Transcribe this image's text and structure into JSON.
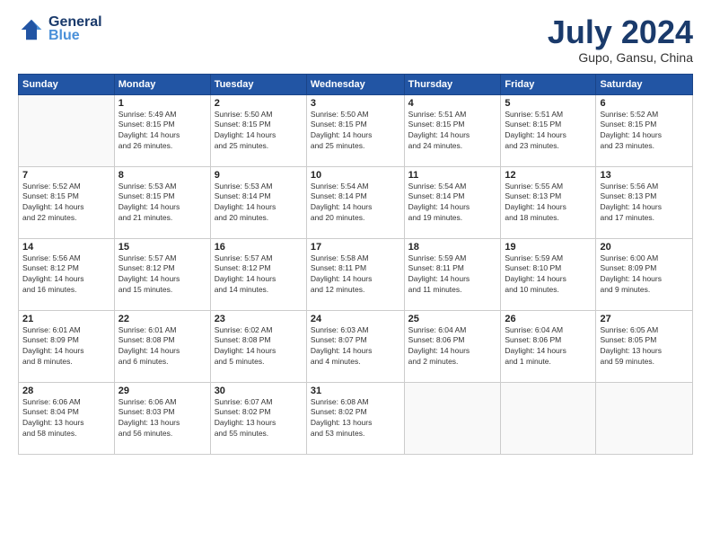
{
  "logo": {
    "line1": "General",
    "line2": "Blue"
  },
  "title": "July 2024",
  "location": "Gupo, Gansu, China",
  "weekdays": [
    "Sunday",
    "Monday",
    "Tuesday",
    "Wednesday",
    "Thursday",
    "Friday",
    "Saturday"
  ],
  "weeks": [
    [
      {
        "day": "",
        "info": ""
      },
      {
        "day": "1",
        "info": "Sunrise: 5:49 AM\nSunset: 8:15 PM\nDaylight: 14 hours\nand 26 minutes."
      },
      {
        "day": "2",
        "info": "Sunrise: 5:50 AM\nSunset: 8:15 PM\nDaylight: 14 hours\nand 25 minutes."
      },
      {
        "day": "3",
        "info": "Sunrise: 5:50 AM\nSunset: 8:15 PM\nDaylight: 14 hours\nand 25 minutes."
      },
      {
        "day": "4",
        "info": "Sunrise: 5:51 AM\nSunset: 8:15 PM\nDaylight: 14 hours\nand 24 minutes."
      },
      {
        "day": "5",
        "info": "Sunrise: 5:51 AM\nSunset: 8:15 PM\nDaylight: 14 hours\nand 23 minutes."
      },
      {
        "day": "6",
        "info": "Sunrise: 5:52 AM\nSunset: 8:15 PM\nDaylight: 14 hours\nand 23 minutes."
      }
    ],
    [
      {
        "day": "7",
        "info": "Sunrise: 5:52 AM\nSunset: 8:15 PM\nDaylight: 14 hours\nand 22 minutes."
      },
      {
        "day": "8",
        "info": "Sunrise: 5:53 AM\nSunset: 8:15 PM\nDaylight: 14 hours\nand 21 minutes."
      },
      {
        "day": "9",
        "info": "Sunrise: 5:53 AM\nSunset: 8:14 PM\nDaylight: 14 hours\nand 20 minutes."
      },
      {
        "day": "10",
        "info": "Sunrise: 5:54 AM\nSunset: 8:14 PM\nDaylight: 14 hours\nand 20 minutes."
      },
      {
        "day": "11",
        "info": "Sunrise: 5:54 AM\nSunset: 8:14 PM\nDaylight: 14 hours\nand 19 minutes."
      },
      {
        "day": "12",
        "info": "Sunrise: 5:55 AM\nSunset: 8:13 PM\nDaylight: 14 hours\nand 18 minutes."
      },
      {
        "day": "13",
        "info": "Sunrise: 5:56 AM\nSunset: 8:13 PM\nDaylight: 14 hours\nand 17 minutes."
      }
    ],
    [
      {
        "day": "14",
        "info": "Sunrise: 5:56 AM\nSunset: 8:12 PM\nDaylight: 14 hours\nand 16 minutes."
      },
      {
        "day": "15",
        "info": "Sunrise: 5:57 AM\nSunset: 8:12 PM\nDaylight: 14 hours\nand 15 minutes."
      },
      {
        "day": "16",
        "info": "Sunrise: 5:57 AM\nSunset: 8:12 PM\nDaylight: 14 hours\nand 14 minutes."
      },
      {
        "day": "17",
        "info": "Sunrise: 5:58 AM\nSunset: 8:11 PM\nDaylight: 14 hours\nand 12 minutes."
      },
      {
        "day": "18",
        "info": "Sunrise: 5:59 AM\nSunset: 8:11 PM\nDaylight: 14 hours\nand 11 minutes."
      },
      {
        "day": "19",
        "info": "Sunrise: 5:59 AM\nSunset: 8:10 PM\nDaylight: 14 hours\nand 10 minutes."
      },
      {
        "day": "20",
        "info": "Sunrise: 6:00 AM\nSunset: 8:09 PM\nDaylight: 14 hours\nand 9 minutes."
      }
    ],
    [
      {
        "day": "21",
        "info": "Sunrise: 6:01 AM\nSunset: 8:09 PM\nDaylight: 14 hours\nand 8 minutes."
      },
      {
        "day": "22",
        "info": "Sunrise: 6:01 AM\nSunset: 8:08 PM\nDaylight: 14 hours\nand 6 minutes."
      },
      {
        "day": "23",
        "info": "Sunrise: 6:02 AM\nSunset: 8:08 PM\nDaylight: 14 hours\nand 5 minutes."
      },
      {
        "day": "24",
        "info": "Sunrise: 6:03 AM\nSunset: 8:07 PM\nDaylight: 14 hours\nand 4 minutes."
      },
      {
        "day": "25",
        "info": "Sunrise: 6:04 AM\nSunset: 8:06 PM\nDaylight: 14 hours\nand 2 minutes."
      },
      {
        "day": "26",
        "info": "Sunrise: 6:04 AM\nSunset: 8:06 PM\nDaylight: 14 hours\nand 1 minute."
      },
      {
        "day": "27",
        "info": "Sunrise: 6:05 AM\nSunset: 8:05 PM\nDaylight: 13 hours\nand 59 minutes."
      }
    ],
    [
      {
        "day": "28",
        "info": "Sunrise: 6:06 AM\nSunset: 8:04 PM\nDaylight: 13 hours\nand 58 minutes."
      },
      {
        "day": "29",
        "info": "Sunrise: 6:06 AM\nSunset: 8:03 PM\nDaylight: 13 hours\nand 56 minutes."
      },
      {
        "day": "30",
        "info": "Sunrise: 6:07 AM\nSunset: 8:02 PM\nDaylight: 13 hours\nand 55 minutes."
      },
      {
        "day": "31",
        "info": "Sunrise: 6:08 AM\nSunset: 8:02 PM\nDaylight: 13 hours\nand 53 minutes."
      },
      {
        "day": "",
        "info": ""
      },
      {
        "day": "",
        "info": ""
      },
      {
        "day": "",
        "info": ""
      }
    ]
  ]
}
